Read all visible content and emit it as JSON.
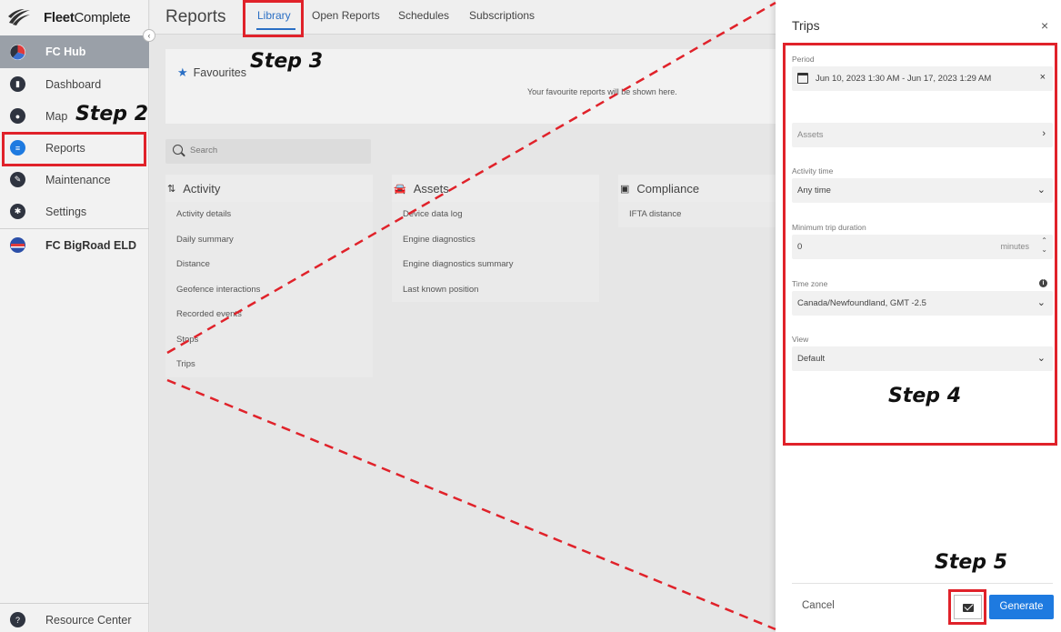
{
  "brand": {
    "name_bold": "Fleet",
    "name_rest": "Complete"
  },
  "sidebar": {
    "hub": "FC Hub",
    "items": [
      {
        "label": "Dashboard",
        "icon": "dashboard-icon"
      },
      {
        "label": "Map",
        "icon": "map-pin-icon"
      },
      {
        "label": "Reports",
        "icon": "reports-icon"
      },
      {
        "label": "Maintenance",
        "icon": "wrench-icon"
      },
      {
        "label": "Settings",
        "icon": "gear-icon"
      }
    ],
    "bigroad": "FC BigRoad ELD",
    "resource_center": "Resource Center",
    "collapse": "‹"
  },
  "header": {
    "title": "Reports",
    "tabs": [
      "Library",
      "Open Reports",
      "Schedules",
      "Subscriptions"
    ]
  },
  "favourites": {
    "title": "Favourites",
    "empty_text": "Your favourite reports will be shown here."
  },
  "search": {
    "placeholder": "Search"
  },
  "categories": [
    {
      "name": "Activity",
      "items": [
        "Activity details",
        "Daily summary",
        "Distance",
        "Geofence interactions",
        "Recorded events",
        "Stops",
        "Trips"
      ]
    },
    {
      "name": "Assets",
      "items": [
        "Device data log",
        "Engine diagnostics",
        "Engine diagnostics summary",
        "Last known position"
      ]
    },
    {
      "name": "Compliance",
      "items": [
        "IFTA distance"
      ]
    }
  ],
  "panel": {
    "title": "Trips",
    "close": "×",
    "period_label": "Period",
    "period_value": "Jun 10, 2023 1:30 AM - Jun 17, 2023 1:29 AM",
    "period_clear": "×",
    "assets_placeholder": "Assets",
    "activity_label": "Activity time",
    "activity_value": "Any time",
    "min_trip_label": "Minimum trip duration",
    "min_trip_value": "0",
    "min_trip_unit": "minutes",
    "timezone_label": "Time zone",
    "timezone_value": "Canada/Newfoundland, GMT -2.5",
    "view_label": "View",
    "view_value": "Default",
    "cancel": "Cancel",
    "generate": "Generate"
  },
  "annotations": {
    "step2": "Step 2",
    "step3": "Step 3",
    "step4": "Step 4",
    "step5": "Step 5",
    "highlight_color": "#e0222a"
  }
}
